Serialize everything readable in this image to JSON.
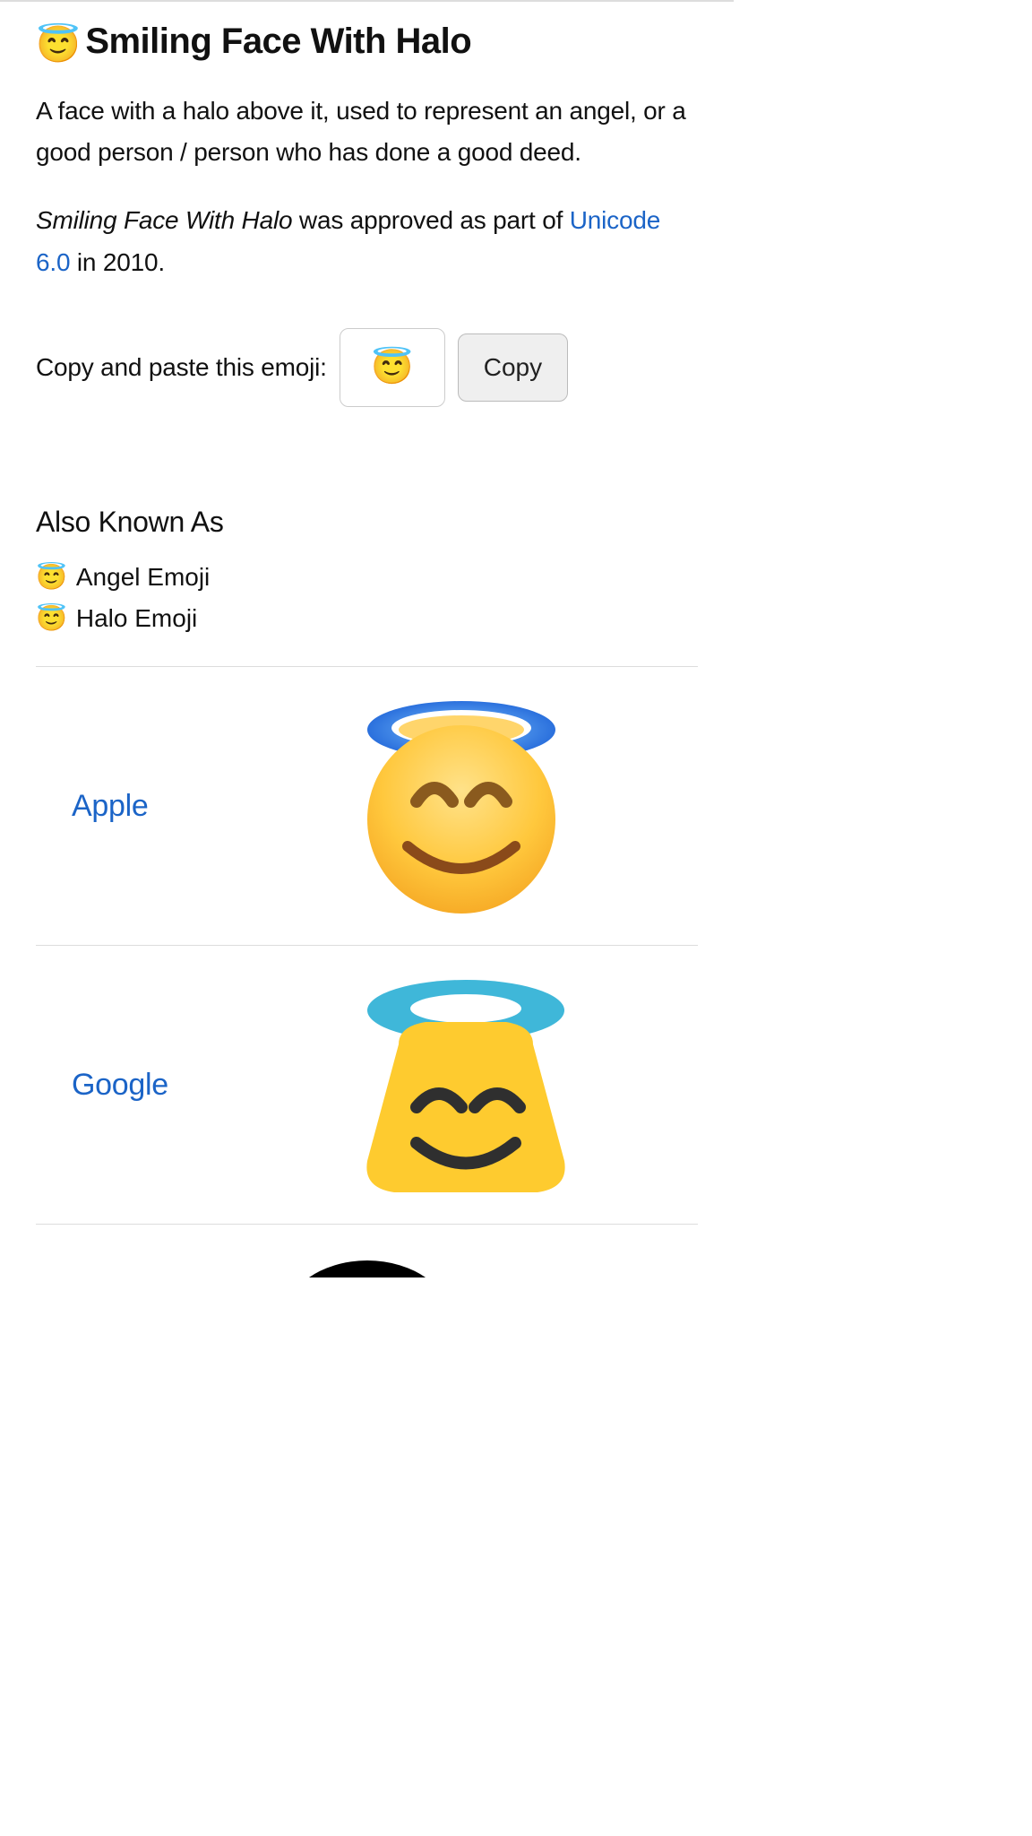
{
  "emoji": "😇",
  "title": "Smiling Face With Halo",
  "description": "A face with a halo above it, used to represent an angel, or a good person / person who has done a good deed.",
  "approval": {
    "name_italic": "Smiling Face With Halo",
    "mid": " was approved as part of ",
    "link_text": "Unicode 6.0",
    "tail": " in 2010."
  },
  "copy": {
    "label": "Copy and paste this emoji:",
    "button": "Copy"
  },
  "aka": {
    "heading": "Also Known As",
    "items": [
      "Angel Emoji",
      "Halo Emoji"
    ]
  },
  "vendors": [
    {
      "name": "Apple"
    },
    {
      "name": "Google"
    }
  ]
}
